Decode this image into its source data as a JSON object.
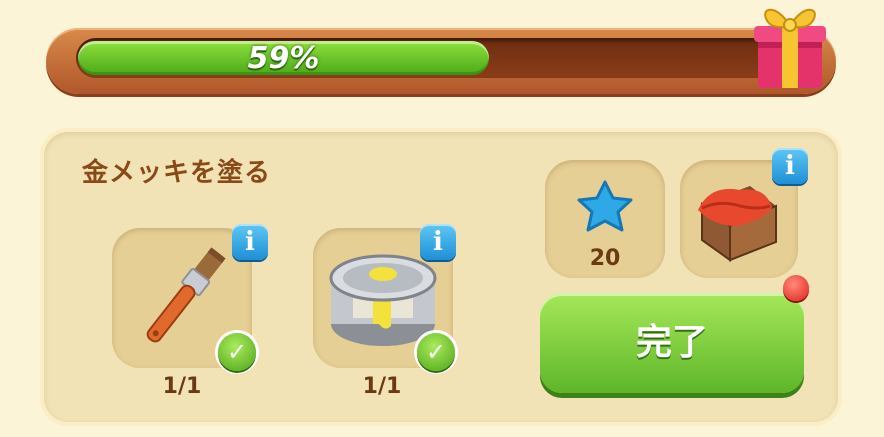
{
  "progress": {
    "percent_label": "59%",
    "value": 0.59
  },
  "task": {
    "title": "金メッキを塗る"
  },
  "requirements": [
    {
      "name": "paintbrush",
      "count": "1/1",
      "completed": true
    },
    {
      "name": "paint-can",
      "count": "1/1",
      "completed": true
    }
  ],
  "rewards": [
    {
      "name": "blue-star",
      "amount": "20"
    },
    {
      "name": "crate-with-cloth",
      "amount": ""
    }
  ],
  "buttons": {
    "complete_label": "完了"
  },
  "colors": {
    "accent_green": "#5eb629",
    "info_blue": "#1f8fd6",
    "title_brown": "#8a4a18"
  }
}
